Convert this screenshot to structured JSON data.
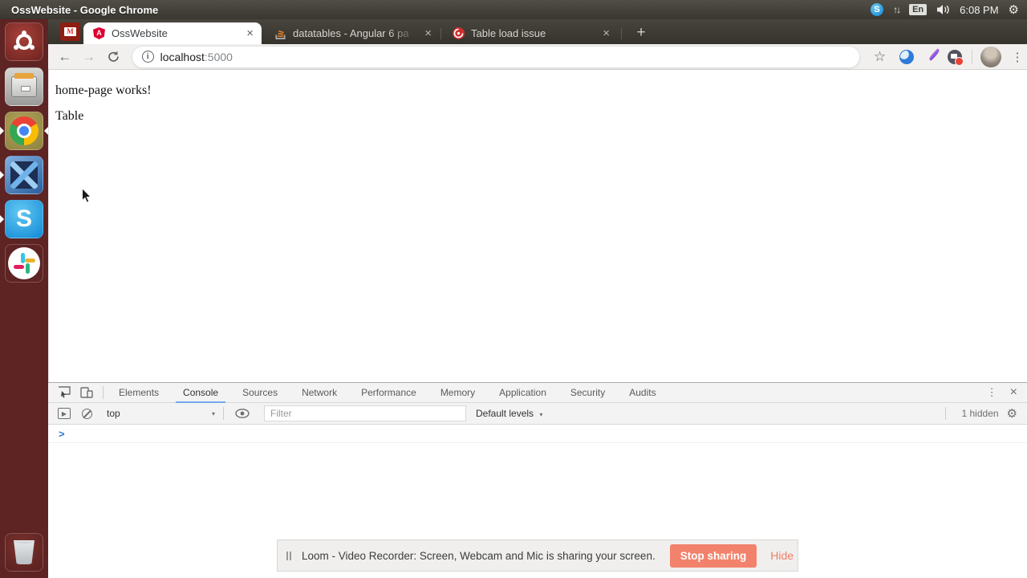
{
  "top_bar": {
    "title": "OssWebsite - Google Chrome",
    "keyboard_layout": "En",
    "time": "6:08 PM"
  },
  "launcher": {
    "items": [
      "ubuntu-dash",
      "files",
      "chrome",
      "vscode",
      "skype",
      "slack",
      "trash"
    ]
  },
  "browser": {
    "pinned_tab_icon": "gmail-icon",
    "tabs": [
      {
        "title": "OssWebsite",
        "icon": "angular-icon",
        "active": true
      },
      {
        "title": "datatables - Angular 6 pa",
        "icon": "stackoverflow-icon",
        "active": false
      },
      {
        "title": "Table load issue",
        "icon": "datatables-forum-icon",
        "active": false
      }
    ],
    "address": {
      "host": "localhost",
      "port": ":5000"
    },
    "favicon_letter": "A",
    "gmail_letter": "M",
    "info_glyph": "i"
  },
  "page": {
    "line1": "home-page works!",
    "line2": "Table"
  },
  "devtools": {
    "tabs": [
      "Elements",
      "Console",
      "Sources",
      "Network",
      "Performance",
      "Memory",
      "Application",
      "Security",
      "Audits"
    ],
    "active_tab": "Console",
    "context_selector": "top",
    "filter_placeholder": "Filter",
    "levels_label": "Default levels",
    "hidden_label": "1 hidden",
    "prompt": ">",
    "console_sidebar_glyph": "▶"
  },
  "share_bar": {
    "message": "Loom - Video Recorder: Screen, Webcam and Mic is sharing your screen.",
    "stop_button": "Stop sharing",
    "hide_button": "Hide"
  },
  "icons": {
    "more": "⋯",
    "close": "×",
    "check": "✓",
    "plus": "+",
    "menu": "⋮",
    "star": "☆",
    "gear": "⚙",
    "back": "←",
    "forward": "→",
    "dropdown": "▾",
    "net_arrows": "↑↓",
    "skype_letter": "S"
  },
  "colors": {
    "coral": "#f2826c",
    "loom_green": "#1ec584",
    "tab_underline": "#73a7f0",
    "prompt_blue": "#2c7ad6",
    "launcher_maroon": "#5e2323",
    "angular_red": "#dd0031"
  }
}
